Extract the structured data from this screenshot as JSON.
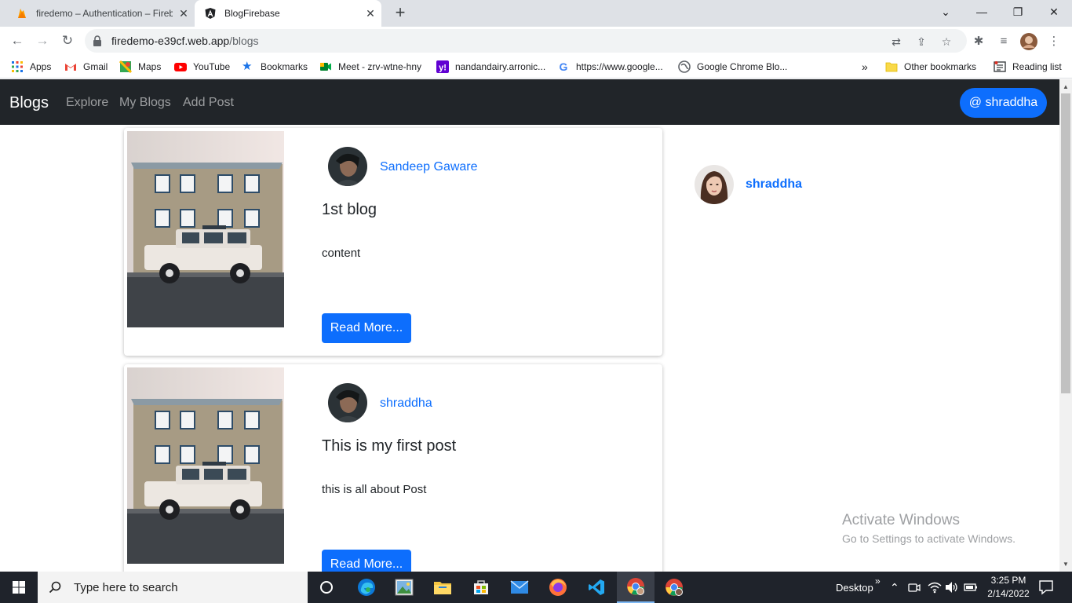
{
  "browser": {
    "tabs": [
      {
        "title": "firedemo – Authentication – Fireb",
        "active": false
      },
      {
        "title": "BlogFirebase",
        "active": true
      }
    ],
    "new_tab": "+",
    "url_domain": "firedemo-e39cf.web.app",
    "url_path": "/blogs",
    "bookmarks": [
      {
        "label": "Apps",
        "icon": "apps-grid-icon"
      },
      {
        "label": "Gmail",
        "icon": "gmail-icon"
      },
      {
        "label": "Maps",
        "icon": "maps-icon"
      },
      {
        "label": "YouTube",
        "icon": "youtube-icon"
      },
      {
        "label": "Bookmarks",
        "icon": "star-icon"
      },
      {
        "label": "Meet - zrv-wtne-hny",
        "icon": "meet-icon"
      },
      {
        "label": "nandandairy.arronic...",
        "icon": "yahoo-icon"
      },
      {
        "label": "https://www.google...",
        "icon": "google-icon"
      },
      {
        "label": "Google Chrome Blo...",
        "icon": "globe-icon"
      }
    ],
    "bookmarks_overflow": "»",
    "other_bookmarks": "Other bookmarks",
    "reading_list": "Reading list"
  },
  "app": {
    "brand": "Blogs",
    "nav": [
      "Explore",
      "My Blogs",
      "Add Post"
    ],
    "user_button": "@ shraddha"
  },
  "posts": [
    {
      "author": "Sandeep Gaware",
      "title": "1st blog",
      "body": "content",
      "button": "Read More..."
    },
    {
      "author": "shraddha",
      "title": "This is my first post",
      "body": "this is all about Post",
      "button": "Read More..."
    }
  ],
  "sidebar": {
    "username": "shraddha"
  },
  "watermark": {
    "line1": "Activate Windows",
    "line2": "Go to Settings to activate Windows."
  },
  "taskbar": {
    "search_placeholder": "Type here to search",
    "desktop_label": "Desktop",
    "overflow": "»",
    "time": "3:25 PM",
    "date": "2/14/2022"
  },
  "colors": {
    "primary": "#0d6efd",
    "navbar": "#212529",
    "taskbar": "#1f232b"
  }
}
